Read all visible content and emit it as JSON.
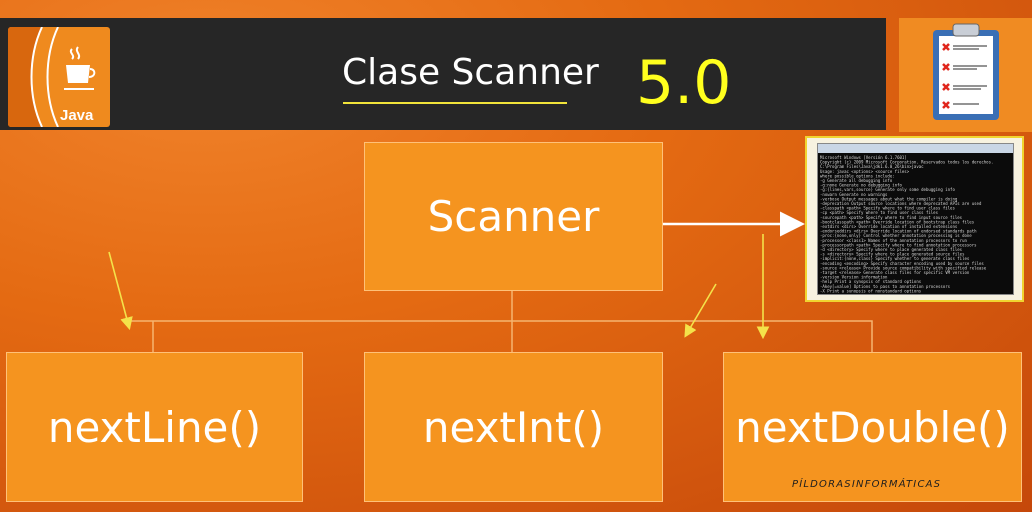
{
  "header": {
    "title": "Clase Scanner",
    "version": "5.0"
  },
  "logo": {
    "brand": "Java",
    "icon": "java-coffee-cup-icon"
  },
  "clipboard_icon": "clipboard-checklist-icon",
  "diagram": {
    "root": "Scanner",
    "methods": [
      "nextLine()",
      "nextInt()",
      "nextDouble()"
    ]
  },
  "console": {
    "lines": [
      "Microsoft Windows [Versión 6.1.7601]",
      "Copyright (c) 2009 Microsoft Corporation. Reservados todos los derechos.",
      "C:\\Program Files\\Java\\jdk1.6.0_26\\bin>javac",
      "Usage: javac <options> <source files>",
      "where possible options include:",
      "  -g                     Generate all debugging info",
      "  -g:none                Generate no debugging info",
      "  -g:{lines,vars,source} Generate only some debugging info",
      "  -nowarn                Generate no warnings",
      "  -verbose               Output messages about what the compiler is doing",
      "  -deprecation           Output source locations where deprecated APIs are used",
      "  -classpath <path>      Specify where to find user class files",
      "  -cp <path>             Specify where to find user class files",
      "  -sourcepath <path>     Specify where to find input source files",
      "  -bootclasspath <path>  Override location of bootstrap class files",
      "  -extdirs <dirs>        Override location of installed extensions",
      "  -endorseddirs <dirs>   Override location of endorsed standards path",
      "  -proc:{none,only}      Control whether annotation processing is done",
      "  -processor <class1>    Names of the annotation processors to run",
      "  -processorpath <path>  Specify where to find annotation processors",
      "  -d <directory>         Specify where to place generated class files",
      "  -s <directory>         Specify where to place generated source files",
      "  -implicit:{none,class} Specify whether to generate class files",
      "  -encoding <encoding>   Specify character encoding used by source files",
      "  -source <release>      Provide source compatibility with specified release",
      "  -target <release>      Generate class files for specific VM version",
      "  -version               Version information",
      "  -help                  Print a synopsis of standard options",
      "  -Akey[=value]          Options to pass to annotation processors",
      "  -X                     Print a synopsis of nonstandard options"
    ]
  },
  "footer": "PÍLDORASINFORMÁTICAS"
}
